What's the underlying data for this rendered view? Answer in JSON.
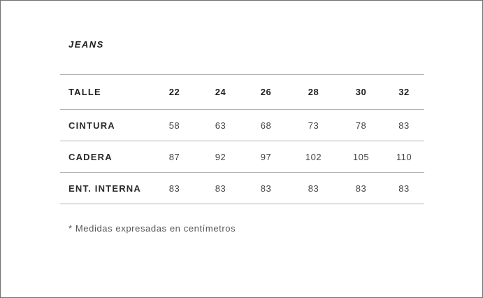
{
  "title": "JEANS",
  "table": {
    "header": {
      "label": "TALLE",
      "cells": [
        "22",
        "24",
        "26",
        "28",
        "30",
        "32"
      ]
    },
    "rows": [
      {
        "label": "CINTURA",
        "cells": [
          "58",
          "63",
          "68",
          "73",
          "78",
          "83"
        ]
      },
      {
        "label": "CADERA",
        "cells": [
          "87",
          "92",
          "97",
          "102",
          "105",
          "110"
        ]
      },
      {
        "label": "ENT. INTERNA",
        "cells": [
          "83",
          "83",
          "83",
          "83",
          "83",
          "83"
        ]
      }
    ]
  },
  "footnote": "* Medidas expresadas en centímetros",
  "colors": {
    "border": "#6f6f6f",
    "rule": "#b3b3b3",
    "text": "#222222"
  }
}
